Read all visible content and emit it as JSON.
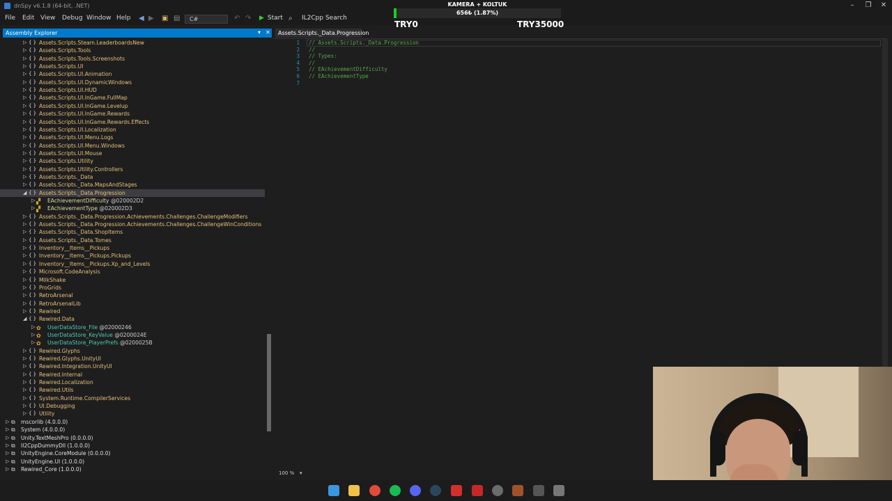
{
  "window": {
    "title": "dnSpy v6.1.8 (64-bit, .NET)",
    "controls": {
      "minimize": "–",
      "maximize": "❐",
      "close": "✕"
    }
  },
  "menu": [
    "File",
    "Edit",
    "View",
    "Debug",
    "Window",
    "Help"
  ],
  "toolbar": {
    "language": "C#",
    "start_label": "Start",
    "il2cpp_label": "IL2Cpp Search"
  },
  "overlay": {
    "title": "KAMERA + KOLTUK",
    "progress_text": "656₺ (1.87%)",
    "progress_fraction": 0.0187,
    "min_label": "TRY0",
    "max_label": "TRY35000",
    "fill_color": "#14d11e"
  },
  "explorer": {
    "title": "Assembly Explorer",
    "rows": [
      {
        "label": "Assets.Scripts.Steam.LeaderboardsNew",
        "kind": "ns",
        "depth": 1,
        "arrow": "▷"
      },
      {
        "label": "Assets.Scripts.Tools",
        "kind": "ns",
        "depth": 1,
        "arrow": "▷"
      },
      {
        "label": "Assets.Scripts.Tools.Screenshots",
        "kind": "ns",
        "depth": 1,
        "arrow": "▷"
      },
      {
        "label": "Assets.Scripts.UI",
        "kind": "ns",
        "depth": 1,
        "arrow": "▷"
      },
      {
        "label": "Assets.Scripts.UI.Animation",
        "kind": "ns",
        "depth": 1,
        "arrow": "▷"
      },
      {
        "label": "Assets.Scripts.UI.DynamicWindows",
        "kind": "ns",
        "depth": 1,
        "arrow": "▷"
      },
      {
        "label": "Assets.Scripts.UI.HUD",
        "kind": "ns",
        "depth": 1,
        "arrow": "▷"
      },
      {
        "label": "Assets.Scripts.UI.InGame.FullMap",
        "kind": "ns",
        "depth": 1,
        "arrow": "▷"
      },
      {
        "label": "Assets.Scripts.UI.InGame.Levelup",
        "kind": "ns",
        "depth": 1,
        "arrow": "▷"
      },
      {
        "label": "Assets.Scripts.UI.InGame.Rewards",
        "kind": "ns",
        "depth": 1,
        "arrow": "▷"
      },
      {
        "label": "Assets.Scripts.UI.InGame.Rewards.Effects",
        "kind": "ns",
        "depth": 1,
        "arrow": "▷"
      },
      {
        "label": "Assets.Scripts.UI.Localization",
        "kind": "ns",
        "depth": 1,
        "arrow": "▷"
      },
      {
        "label": "Assets.Scripts.UI.Menu.Logs",
        "kind": "ns",
        "depth": 1,
        "arrow": "▷"
      },
      {
        "label": "Assets.Scripts.UI.Menu.Windows",
        "kind": "ns",
        "depth": 1,
        "arrow": "▷"
      },
      {
        "label": "Assets.Scripts.UI.Mouse",
        "kind": "ns",
        "depth": 1,
        "arrow": "▷"
      },
      {
        "label": "Assets.Scripts.Utility",
        "kind": "ns",
        "depth": 1,
        "arrow": "▷"
      },
      {
        "label": "Assets.Scripts.Utility.Controllers",
        "kind": "ns",
        "depth": 1,
        "arrow": "▷"
      },
      {
        "label": "Assets.Scripts._Data",
        "kind": "ns",
        "depth": 1,
        "arrow": "▷"
      },
      {
        "label": "Assets.Scripts._Data.MapsAndStages",
        "kind": "ns",
        "depth": 1,
        "arrow": "▷"
      },
      {
        "label": "Assets.Scripts._Data.Progression",
        "kind": "ns",
        "depth": 1,
        "arrow": "◢",
        "selected": true
      },
      {
        "label": "EAchievementDifficulty",
        "token": "@020002D2",
        "kind": "enum",
        "depth": 2,
        "arrow": "▷"
      },
      {
        "label": "EAchievementType",
        "token": "@020002D3",
        "kind": "enum",
        "depth": 2,
        "arrow": "▷"
      },
      {
        "label": "Assets.Scripts._Data.Progression.Achievements.Challenges.ChallengeModifiers",
        "kind": "ns",
        "depth": 1,
        "arrow": "▷"
      },
      {
        "label": "Assets.Scripts._Data.Progression.Achievements.Challenges.ChallengeWinConditions",
        "kind": "ns",
        "depth": 1,
        "arrow": "▷"
      },
      {
        "label": "Assets.Scripts._Data.ShopItems",
        "kind": "ns",
        "depth": 1,
        "arrow": "▷"
      },
      {
        "label": "Assets.Scripts._Data.Tomes",
        "kind": "ns",
        "depth": 1,
        "arrow": "▷"
      },
      {
        "label": "Inventory__Items__Pickups",
        "kind": "ns",
        "depth": 1,
        "arrow": "▷"
      },
      {
        "label": "Inventory__Items__Pickups.Pickups",
        "kind": "ns",
        "depth": 1,
        "arrow": "▷"
      },
      {
        "label": "Inventory__Items__Pickups.Xp_and_Levels",
        "kind": "ns",
        "depth": 1,
        "arrow": "▷"
      },
      {
        "label": "Microsoft.CodeAnalysis",
        "kind": "ns",
        "depth": 1,
        "arrow": "▷"
      },
      {
        "label": "MilkShake",
        "kind": "ns",
        "depth": 1,
        "arrow": "▷"
      },
      {
        "label": "ProGrids",
        "kind": "ns",
        "depth": 1,
        "arrow": "▷"
      },
      {
        "label": "RetroArsenal",
        "kind": "ns",
        "depth": 1,
        "arrow": "▷"
      },
      {
        "label": "RetroArsenalLib",
        "kind": "ns",
        "depth": 1,
        "arrow": "▷"
      },
      {
        "label": "Rewired",
        "kind": "ns",
        "depth": 1,
        "arrow": "▷"
      },
      {
        "label": "Rewired.Data",
        "kind": "ns",
        "depth": 1,
        "arrow": "◢"
      },
      {
        "label": "UserDataStore_File",
        "token": "@02000246",
        "kind": "class",
        "depth": 2,
        "arrow": "▷"
      },
      {
        "label": "UserDataStore_KeyValue",
        "token": "@0200024E",
        "kind": "class",
        "depth": 2,
        "arrow": "▷"
      },
      {
        "label": "UserDataStore_PlayerPrefs",
        "token": "@0200025B",
        "kind": "class",
        "depth": 2,
        "arrow": "▷"
      },
      {
        "label": "Rewired.Glyphs",
        "kind": "ns",
        "depth": 1,
        "arrow": "▷"
      },
      {
        "label": "Rewired.Glyphs.UnityUI",
        "kind": "ns",
        "depth": 1,
        "arrow": "▷"
      },
      {
        "label": "Rewired.Integration.UnityUI",
        "kind": "ns",
        "depth": 1,
        "arrow": "▷"
      },
      {
        "label": "Rewired.Internal",
        "kind": "ns",
        "depth": 1,
        "arrow": "▷"
      },
      {
        "label": "Rewired.Localization",
        "kind": "ns",
        "depth": 1,
        "arrow": "▷"
      },
      {
        "label": "Rewired.Utils",
        "kind": "ns",
        "depth": 1,
        "arrow": "▷"
      },
      {
        "label": "System.Runtime.CompilerServices",
        "kind": "ns",
        "depth": 1,
        "arrow": "▷"
      },
      {
        "label": "UI.Debugging",
        "kind": "ns",
        "depth": 1,
        "arrow": "▷"
      },
      {
        "label": "Utility",
        "kind": "ns",
        "depth": 1,
        "arrow": "▷"
      },
      {
        "label": "mscorlib (4.0.0.0)",
        "kind": "asm",
        "depth": 0,
        "arrow": "▷"
      },
      {
        "label": "System (4.0.0.0)",
        "kind": "asm",
        "depth": 0,
        "arrow": "▷"
      },
      {
        "label": "Unity.TextMeshPro (0.0.0.0)",
        "kind": "asm",
        "depth": 0,
        "arrow": "▷"
      },
      {
        "label": "Il2CppDummyDll (1.0.0.0)",
        "kind": "asm",
        "depth": 0,
        "arrow": "▷"
      },
      {
        "label": "UnityEngine.CoreModule (0.0.0.0)",
        "kind": "asm",
        "depth": 0,
        "arrow": "▷"
      },
      {
        "label": "UnityEngine.UI (1.0.0.0)",
        "kind": "asm",
        "depth": 0,
        "arrow": "▷"
      },
      {
        "label": "Rewired_Core (1.0.0.0)",
        "kind": "asm",
        "depth": 0,
        "arrow": "▷"
      }
    ]
  },
  "editor": {
    "tab_title": "Assets.Scripts._Data.Progression",
    "lines": [
      {
        "no": "1",
        "text": "// Assets.Scripts._Data.Progression"
      },
      {
        "no": "2",
        "text": "//"
      },
      {
        "no": "3",
        "text": "// Types:"
      },
      {
        "no": "4",
        "text": "//"
      },
      {
        "no": "5",
        "text": "// EAchievementDifficulty"
      },
      {
        "no": "6",
        "text": "// EAchievementType"
      },
      {
        "no": "7",
        "text": ""
      }
    ],
    "zoom": "100 %"
  },
  "taskbar": {
    "apps": [
      {
        "name": "windows-start",
        "color": "#3a96dd"
      },
      {
        "name": "file-explorer",
        "color": "#f0c24b"
      },
      {
        "name": "chrome",
        "color": "#e14b3b"
      },
      {
        "name": "spotify",
        "color": "#1db954"
      },
      {
        "name": "discord",
        "color": "#5865f2"
      },
      {
        "name": "steam",
        "color": "#2a475e"
      },
      {
        "name": "app-red",
        "color": "#d32f2f"
      },
      {
        "name": "app-stripes",
        "color": "#c62828"
      },
      {
        "name": "obs",
        "color": "#6b6b6b"
      },
      {
        "name": "app-character",
        "color": "#a0522d"
      },
      {
        "name": "archive",
        "color": "#555555"
      },
      {
        "name": "dnspy",
        "color": "#777777"
      }
    ]
  }
}
